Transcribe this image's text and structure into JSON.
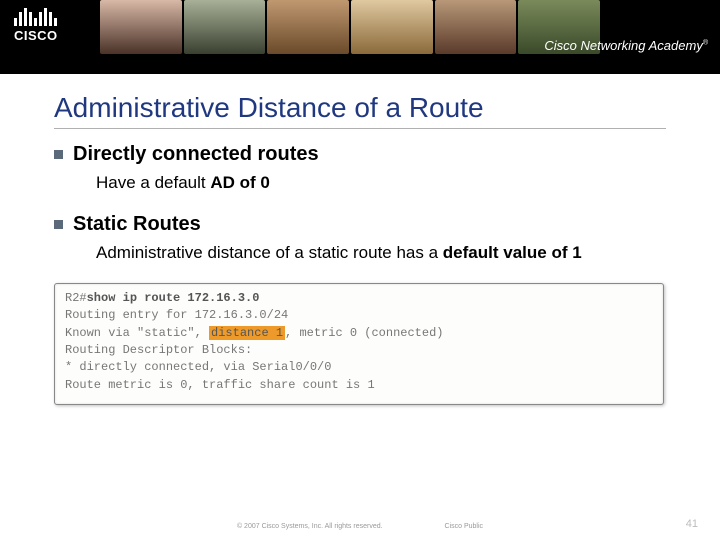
{
  "header": {
    "logo_text": "CISCO",
    "academy_label": "Cisco Networking Academy",
    "tm": "®"
  },
  "slide": {
    "title": "Administrative Distance of a Route",
    "bullets": [
      {
        "heading": "Directly connected routes",
        "sub_prefix": "Have a default ",
        "sub_bold": "AD of 0",
        "sub_suffix": ""
      },
      {
        "heading": "Static Routes",
        "sub_prefix": "Administrative distance of a static route has a ",
        "sub_bold": "default value of 1",
        "sub_suffix": ""
      }
    ]
  },
  "cli": {
    "prompt": "R2#",
    "command": "show ip route 172.16.3.0",
    "line1": "Routing entry for 172.16.3.0/24",
    "line2_pre": "Known via \"static\", ",
    "line2_hl": "distance 1",
    "line2_post": ", metric 0 (connected)",
    "line3": "  Routing Descriptor Blocks:",
    "line4": "  * directly connected, via Serial0/0/0",
    "line5": "      Route metric is 0, traffic share count is 1"
  },
  "footer": {
    "copyright": "© 2007 Cisco Systems, Inc. All rights reserved.",
    "classification": "Cisco Public",
    "page": "41"
  }
}
